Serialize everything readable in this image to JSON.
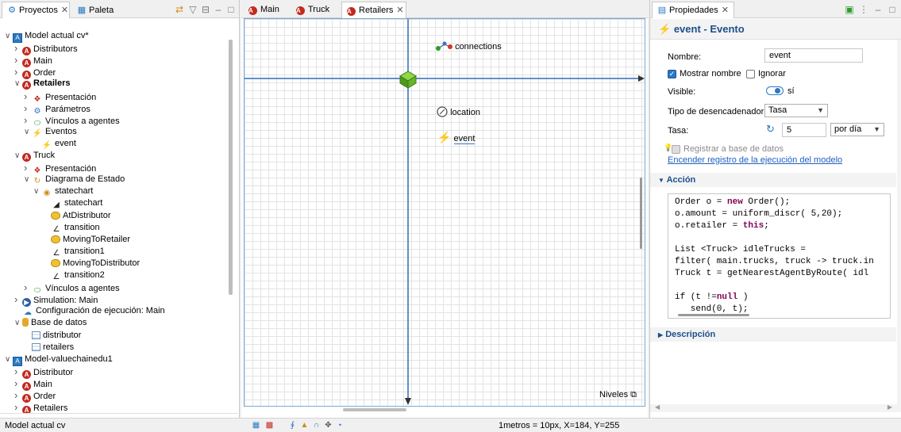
{
  "left_panel": {
    "tabs": [
      {
        "label": "Proyectos",
        "icon": "projects-icon"
      },
      {
        "label": "Paleta",
        "icon": "palette-icon"
      }
    ],
    "tree": [
      {
        "label": "Model actual cv*",
        "icon": "model-icon",
        "depth": 0,
        "expanded": true
      },
      {
        "label": "Distributors",
        "icon": "agent-icon",
        "depth": 1,
        "expanded": false
      },
      {
        "label": "Main",
        "icon": "agent-icon",
        "depth": 1,
        "expanded": false
      },
      {
        "label": "Order",
        "icon": "agent-icon",
        "depth": 1,
        "expanded": false
      },
      {
        "label": "Retailers",
        "icon": "agent-icon",
        "depth": 1,
        "expanded": true,
        "bold": true
      },
      {
        "label": "Presentación",
        "icon": "presentation-icon",
        "depth": 2,
        "expanded": false
      },
      {
        "label": "Parámetros",
        "icon": "parameters-icon",
        "depth": 2,
        "expanded": false
      },
      {
        "label": "Vínculos a agentes",
        "icon": "links-icon",
        "depth": 2,
        "expanded": false
      },
      {
        "label": "Eventos",
        "icon": "events-icon",
        "depth": 2,
        "expanded": true
      },
      {
        "label": "event",
        "icon": "event-icon",
        "depth": 3
      },
      {
        "label": "Truck",
        "icon": "agent-icon",
        "depth": 1,
        "expanded": true
      },
      {
        "label": "Presentación",
        "icon": "presentation-icon",
        "depth": 2,
        "expanded": false
      },
      {
        "label": "Diagrama de Estado",
        "icon": "statechart-diagram-icon",
        "depth": 2,
        "expanded": true
      },
      {
        "label": "statechart",
        "icon": "statechart-icon",
        "depth": 3,
        "expanded": true
      },
      {
        "label": "statechart",
        "icon": "entry-point-icon",
        "depth": 4
      },
      {
        "label": "AtDistributor",
        "icon": "state-icon",
        "depth": 4
      },
      {
        "label": "transition",
        "icon": "transition-icon",
        "depth": 4
      },
      {
        "label": "MovingToRetailer",
        "icon": "state-icon",
        "depth": 4
      },
      {
        "label": "transition1",
        "icon": "transition-icon",
        "depth": 4
      },
      {
        "label": "MovingToDistributor",
        "icon": "state-icon",
        "depth": 4
      },
      {
        "label": "transition2",
        "icon": "transition-icon",
        "depth": 4
      },
      {
        "label": "Vínculos a agentes",
        "icon": "links-icon",
        "depth": 2,
        "expanded": false
      },
      {
        "label": "Simulation: Main",
        "icon": "simulation-icon",
        "depth": 1,
        "expanded": false
      },
      {
        "label": "Configuración de ejecución: Main",
        "icon": "run-config-icon",
        "depth": 1
      },
      {
        "label": "Base de datos",
        "icon": "database-icon",
        "depth": 1,
        "expanded": true
      },
      {
        "label": "distributor",
        "icon": "table-icon",
        "depth": 2
      },
      {
        "label": "retailers",
        "icon": "table-icon",
        "depth": 2
      },
      {
        "label": "Model-valuechainedu1",
        "icon": "model-icon",
        "depth": 0,
        "expanded": true
      },
      {
        "label": "Distributor",
        "icon": "agent-icon",
        "depth": 1,
        "expanded": false
      },
      {
        "label": "Main",
        "icon": "agent-icon",
        "depth": 1,
        "expanded": false
      },
      {
        "label": "Order",
        "icon": "agent-icon",
        "depth": 1,
        "expanded": false
      },
      {
        "label": "Retailers",
        "icon": "agent-icon",
        "depth": 1,
        "expanded": false
      }
    ]
  },
  "editor": {
    "tabs": [
      {
        "label": "Main",
        "active": false
      },
      {
        "label": "Truck",
        "active": false
      },
      {
        "label": "Retailers",
        "active": true
      }
    ],
    "canvas_items": {
      "connections": "connections",
      "location": "location",
      "event": "event"
    },
    "niveles": "Niveles"
  },
  "properties": {
    "tab_label": "Propiedades",
    "header": "event - Evento",
    "nombre_label": "Nombre:",
    "nombre_value": "event",
    "mostrar_nombre": "Mostrar nombre",
    "mostrar_nombre_checked": true,
    "ignorar": "Ignorar",
    "ignorar_checked": false,
    "visible_label": "Visible:",
    "visible_value": "sí",
    "tipo_label": "Tipo de desencadenador:",
    "tipo_value": "Tasa",
    "tasa_label": "Tasa:",
    "tasa_value": "5",
    "tasa_unit": "por día",
    "registrar": "Registrar a base de datos",
    "encender_link": "Encender registro de la ejecución del modelo",
    "accion_section": "Acción",
    "code_lines": [
      "Order o = new Order();",
      "o.amount = uniform_discr( 5,20);",
      "o.retailer = this;",
      "",
      "List <Truck> idleTrucks =",
      "filter( main.trucks, truck -> truck.in",
      "Truck t = getNearestAgentByRoute( idl",
      "",
      "if (t !=null )",
      "   send(0, t);"
    ],
    "descripcion_section": "Descripción"
  },
  "status": {
    "left_text": "Model actual cv",
    "scale_text": "1metros = 10px, X=184, Y=255"
  },
  "colors": {
    "accent": "#2b78c4",
    "header_text": "#1c4f8c",
    "axis": "#2f6db5",
    "agent_red": "#c2291f"
  }
}
